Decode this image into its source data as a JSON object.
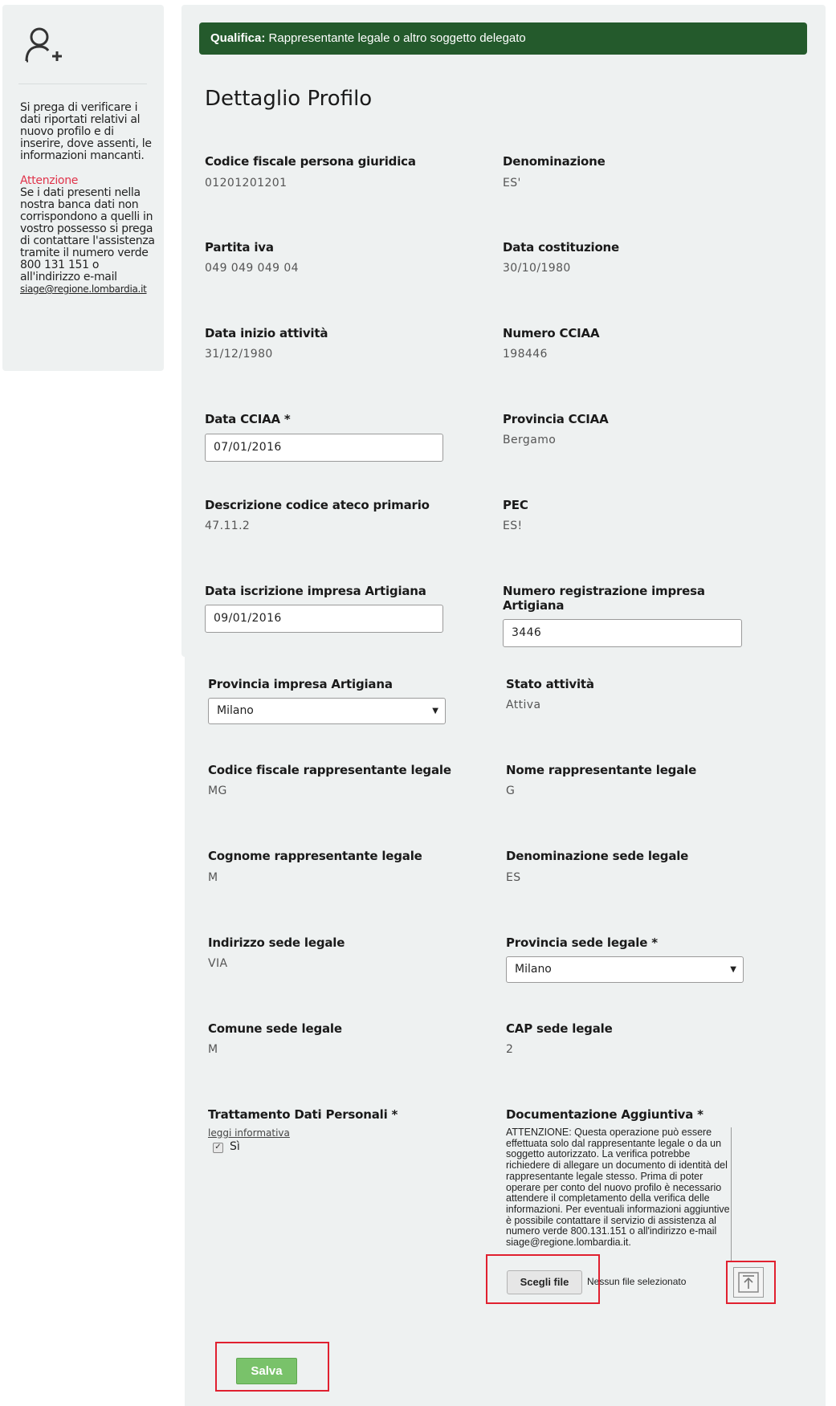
{
  "sidebar": {
    "info": "Si prega di verificare i dati riportati relativi al nuovo profilo e di inserire, dove assenti, le informazioni mancanti.",
    "warning_title": "Attenzione",
    "warning_text": "Se i dati presenti nella nostra banca dati non corrispondono a quelli in vostro possesso si prega di contattare l'assistenza tramite il numero verde 800 131 151 o all'indirizzo e-mail",
    "email": "siage@regione.lombardia.it"
  },
  "header": {
    "qualifica_label": "Qualifica:",
    "qualifica_value": "Rappresentante legale o altro soggetto delegato"
  },
  "page_title": "Dettaglio Profilo",
  "fields": {
    "cf_giuridica": {
      "label": "Codice fiscale persona giuridica",
      "value": "01201201201"
    },
    "denominazione": {
      "label": "Denominazione",
      "value": "ES'"
    },
    "partita_iva": {
      "label": "Partita iva",
      "value": "049 049 049 04"
    },
    "data_costituzione": {
      "label": "Data costituzione",
      "value": "30/10/1980"
    },
    "data_inizio": {
      "label": "Data inizio attività",
      "value": "31/12/1980"
    },
    "numero_cciaa": {
      "label": "Numero CCIAA",
      "value": "198446"
    },
    "data_cciaa": {
      "label": "Data CCIAA *",
      "value": "07/01/2016"
    },
    "provincia_cciaa": {
      "label": "Provincia CCIAA",
      "value": "Bergamo"
    },
    "ateco": {
      "label": "Descrizione codice ateco primario",
      "value": "47.11.2"
    },
    "pec": {
      "label": "PEC",
      "value": "ES!"
    },
    "data_artigiana": {
      "label": "Data iscrizione impresa Artigiana",
      "value": "09/01/2016"
    },
    "num_artigiana": {
      "label": "Numero registrazione impresa Artigiana",
      "value": "3446"
    },
    "prov_artigiana": {
      "label": "Provincia impresa Artigiana",
      "value": "Milano"
    },
    "stato": {
      "label": "Stato attività",
      "value": "Attiva"
    },
    "cf_rappr": {
      "label": "Codice fiscale rappresentante legale",
      "value": "MG"
    },
    "nome_rappr": {
      "label": "Nome rappresentante legale",
      "value": "G"
    },
    "cognome_rappr": {
      "label": "Cognome rappresentante legale",
      "value": "M"
    },
    "denom_sede": {
      "label": "Denominazione sede legale",
      "value": "ES"
    },
    "indirizzo_sede": {
      "label": "Indirizzo sede legale",
      "value": "VIA"
    },
    "prov_sede": {
      "label": "Provincia sede legale *",
      "value": "Milano"
    },
    "comune_sede": {
      "label": "Comune sede legale",
      "value": "M"
    },
    "cap_sede": {
      "label": "CAP sede legale",
      "value": "2"
    }
  },
  "privacy": {
    "label": "Trattamento Dati Personali *",
    "link": "leggi informativa",
    "checkbox_label": "Sì"
  },
  "documentazione": {
    "label": "Documentazione Aggiuntiva *",
    "text": "ATTENZIONE: Questa operazione può essere effettuata solo dal rappresentante legale o da un soggetto autorizzato. La verifica potrebbe richiedere di allegare un documento di identità del rappresentante legale stesso. Prima di poter operare per conto del nuovo profilo è necessario attendere il completamento della verifica delle informazioni. Per eventuali informazioni aggiuntive è possibile contattare il servizio di assistenza al numero verde 800.131.151 o all'indirizzo e-mail siage@regione.lombardia.it.",
    "choose_file": "Scegli file",
    "no_file": "Nessun file selezionato"
  },
  "save_label": "Salva"
}
